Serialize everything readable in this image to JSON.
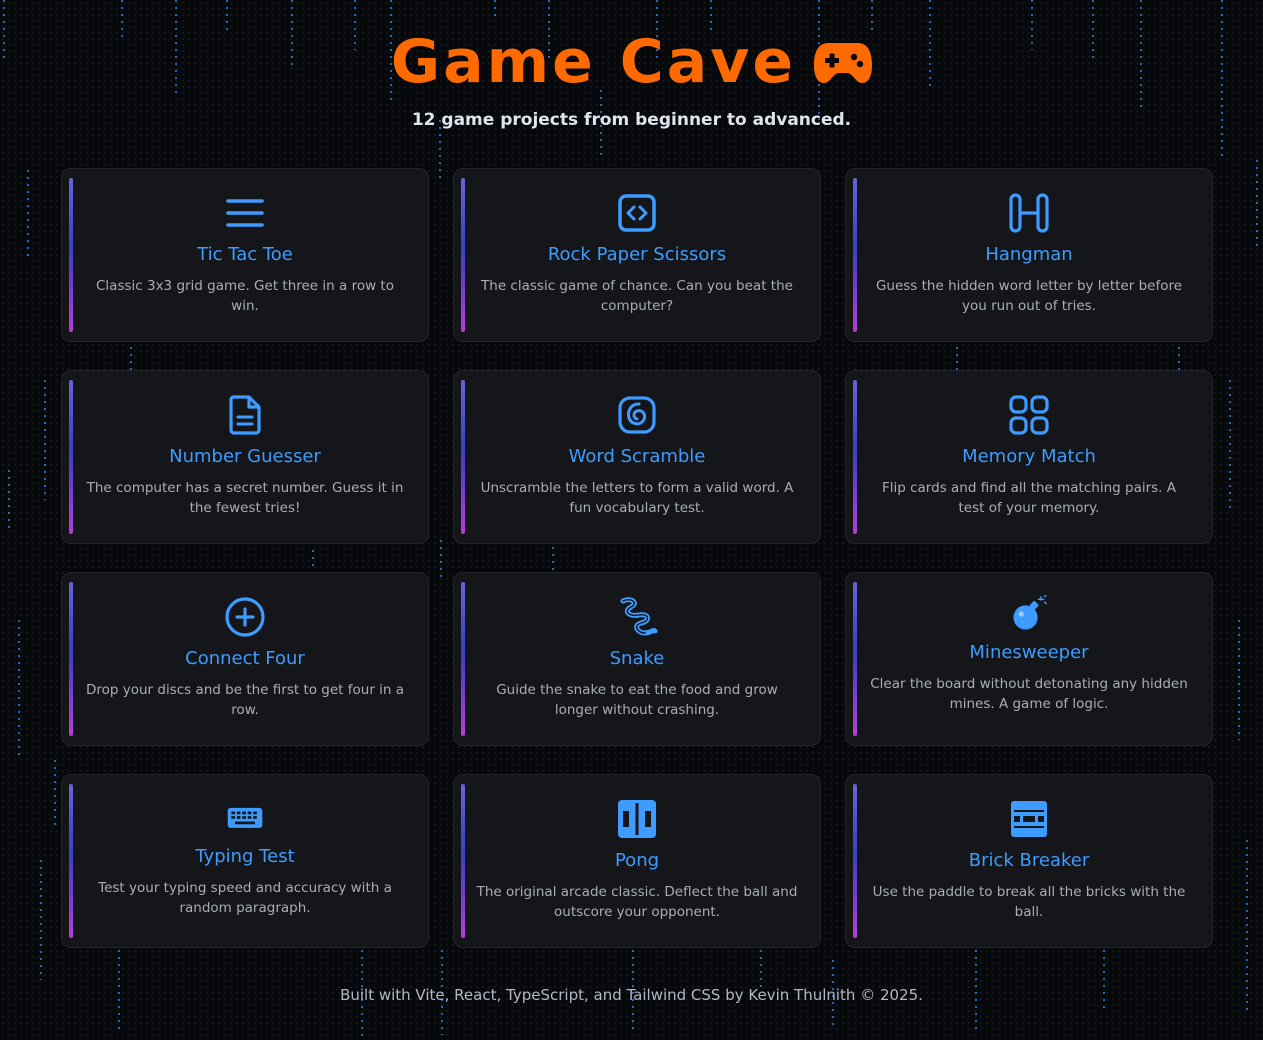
{
  "header": {
    "title": "Game Cave",
    "title_icon": "gamepad-icon",
    "subtitle": "12 game projects from beginner to advanced."
  },
  "colors": {
    "accent": "#3e9bff",
    "title": "#ff6a00",
    "card_bg": "#15161a",
    "background": "#07080b"
  },
  "games": [
    {
      "name": "Tic Tac Toe",
      "description": "Classic 3x3 grid game. Get three in a row to win.",
      "icon": "menu-lines-icon"
    },
    {
      "name": "Rock Paper Scissors",
      "description": "The classic game of chance. Can you beat the computer?",
      "icon": "code-box-icon"
    },
    {
      "name": "Hangman",
      "description": "Guess the hidden word letter by letter before you run out of tries.",
      "icon": "gallows-icon"
    },
    {
      "name": "Number Guesser",
      "description": "The computer has a secret number. Guess it in the fewest tries!",
      "icon": "document-icon"
    },
    {
      "name": "Word Scramble",
      "description": "Unscramble the letters to form a valid word. A fun vocabulary test.",
      "icon": "swirl-icon"
    },
    {
      "name": "Memory Match",
      "description": "Flip cards and find all the matching pairs. A test of your memory.",
      "icon": "grid-icon"
    },
    {
      "name": "Connect Four",
      "description": "Drop your discs and be the first to get four in a row.",
      "icon": "plus-circle-icon"
    },
    {
      "name": "Snake",
      "description": "Guide the snake to eat the food and grow longer without crashing.",
      "icon": "snake-icon"
    },
    {
      "name": "Minesweeper",
      "description": "Clear the board without detonating any hidden mines. A game of logic.",
      "icon": "bomb-icon"
    },
    {
      "name": "Typing Test",
      "description": "Test your typing speed and accuracy with a random paragraph.",
      "icon": "keyboard-icon"
    },
    {
      "name": "Pong",
      "description": "The original arcade classic. Deflect the ball and outscore your opponent.",
      "icon": "pong-icon"
    },
    {
      "name": "Brick Breaker",
      "description": "Use the paddle to break all the bricks with the ball.",
      "icon": "bricks-icon"
    }
  ],
  "footer": {
    "text": "Built with Vite, React, TypeScript, and Tailwind CSS by Kevin Thulnith © 2025."
  }
}
